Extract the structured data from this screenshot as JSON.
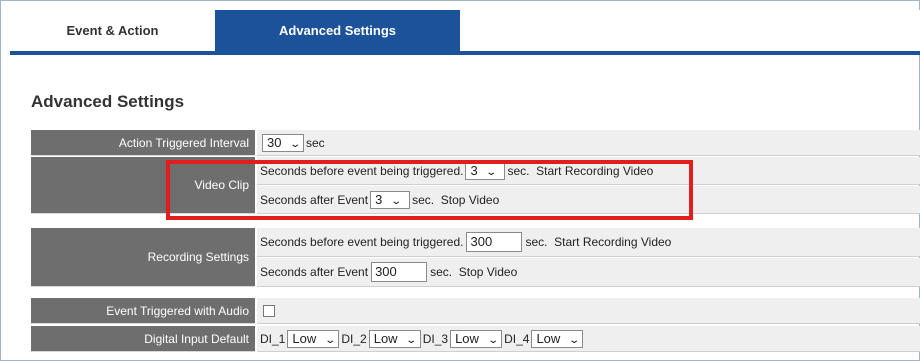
{
  "tabs": [
    {
      "label": "Event & Action"
    },
    {
      "label": "Advanced Settings"
    }
  ],
  "section_title": "Advanced Settings",
  "rows": {
    "action_triggered_interval": {
      "label": "Action Triggered Interval",
      "value": "30",
      "unit": "sec"
    },
    "video_clip": {
      "label": "Video Clip",
      "before_text": "Seconds before event being triggered.",
      "before_value": "3",
      "before_suffix": "sec.  Start Recording Video",
      "after_text": "Seconds after Event",
      "after_value": "3",
      "after_suffix": "sec.  Stop Video"
    },
    "recording_settings": {
      "label": "Recording Settings",
      "before_text": "Seconds before event being triggered.",
      "before_value": "300",
      "before_suffix": "sec.  Start Recording Video",
      "after_text": "Seconds after Event",
      "after_value": "300",
      "after_suffix": "sec.  Stop Video"
    },
    "event_triggered_audio": {
      "label": "Event Triggered with Audio",
      "checked": false
    },
    "digital_input_default": {
      "label": "Digital Input Default",
      "inputs": [
        {
          "name": "DI_1",
          "value": "Low"
        },
        {
          "name": "DI_2",
          "value": "Low"
        },
        {
          "name": "DI_3",
          "value": "Low"
        },
        {
          "name": "DI_4",
          "value": "Low"
        }
      ]
    }
  },
  "colors": {
    "tab_active_bg": "#1c5299",
    "label_bg": "#6e6e6e",
    "value_bg": "#efefef",
    "highlight": "#e21d1d"
  },
  "icons": {
    "dropdown": "chevron-down-icon"
  }
}
